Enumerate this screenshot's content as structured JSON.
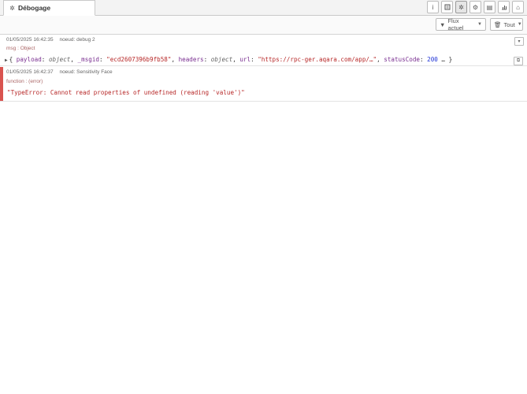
{
  "tab": {
    "label": "Débogage",
    "icon": "bug-icon"
  },
  "sidebar_buttons": [
    {
      "name": "info",
      "glyph": "i"
    },
    {
      "name": "help",
      "glyph": "📖"
    },
    {
      "name": "debug",
      "glyph": "✲"
    },
    {
      "name": "config",
      "glyph": "⚙"
    },
    {
      "name": "context",
      "glyph": "▤"
    },
    {
      "name": "dashboard",
      "glyph": "▥"
    },
    {
      "name": "home",
      "glyph": "⌂"
    }
  ],
  "toolbar": {
    "filter_label": "Flux actuel",
    "clear_label": "Tout"
  },
  "messages": [
    {
      "timestamp": "01/05/2025 16:42:35",
      "node": "noeud: debug 2",
      "topic": "msg : Object",
      "payload_open": "{ ",
      "k_payload": "payload",
      "colon1": ": ",
      "v_payload": "object",
      "comma1": ", ",
      "k_msgid": "_msgid",
      "colon2": ": ",
      "v_msgid": "\"ecd2607396b9fb58\"",
      "comma2": ", ",
      "k_headers": "headers",
      "colon3": ": ",
      "v_headers": "object",
      "comma3": ", ",
      "k_url": "url",
      "colon4": ": ",
      "v_url": "\"https://rpc-ger.aqara.com/app/…\"",
      "comma4": ", ",
      "k_status": "statusCode",
      "colon5": ": ",
      "v_status": "200",
      "payload_close": " … }"
    },
    {
      "timestamp": "01/05/2025 16:42:37",
      "node": "noeud: Sensitivity Face",
      "topic": "function : (error)",
      "payload": "\"TypeError: Cannot read properties of undefined (reading 'value')\""
    }
  ],
  "colors": {
    "error_bar": "#d9534f",
    "string": "#b72828",
    "key": "#792e90",
    "number": "#2033d6"
  }
}
